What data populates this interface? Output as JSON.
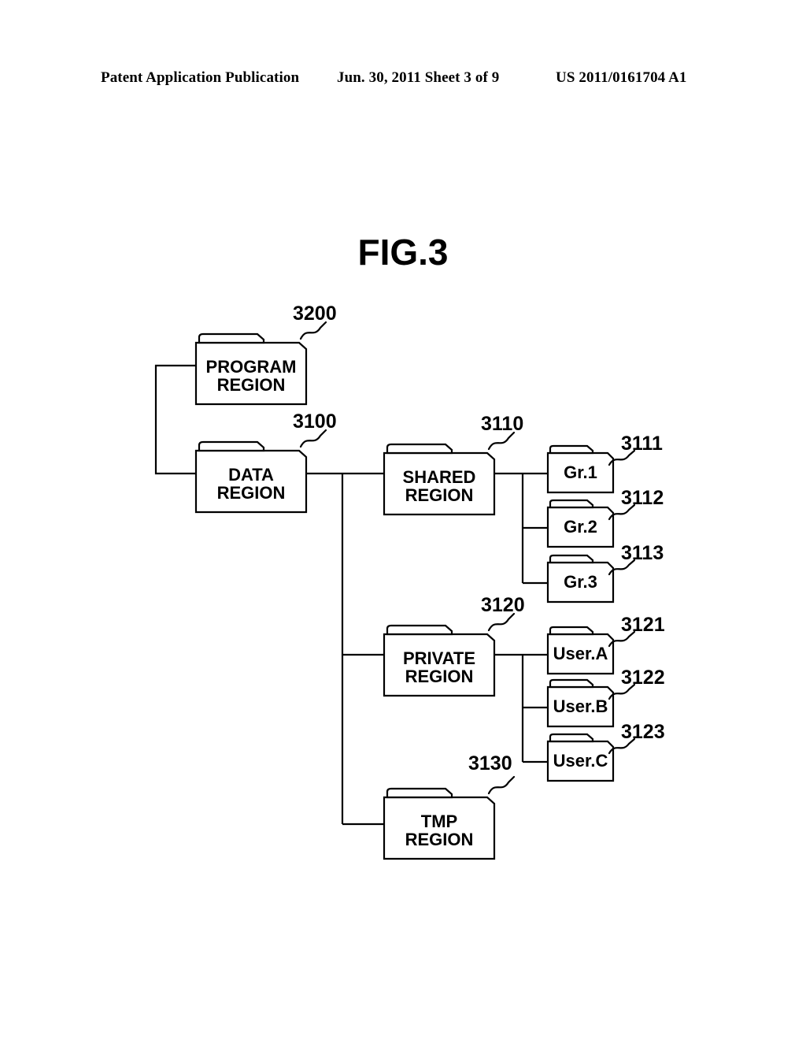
{
  "header": {
    "left": "Patent Application Publication",
    "middle": "Jun. 30, 2011  Sheet 3 of 9",
    "right": "US 2011/0161704 A1"
  },
  "figure": {
    "title": "FIG.3"
  },
  "diagram": {
    "nodes": [
      {
        "id": "program_region",
        "label": "PROGRAM\nREGION",
        "ref": "3200",
        "size": "big"
      },
      {
        "id": "data_region",
        "label": "DATA\nREGION",
        "ref": "3100",
        "size": "big"
      },
      {
        "id": "shared_region",
        "label": "SHARED\nREGION",
        "ref": "3110",
        "size": "big"
      },
      {
        "id": "private_region",
        "label": "PRIVATE\nREGION",
        "ref": "3120",
        "size": "big"
      },
      {
        "id": "tmp_region",
        "label": "TMP\nREGION",
        "ref": "3130",
        "size": "big"
      },
      {
        "id": "gr1",
        "label": "Gr.1",
        "ref": "3111",
        "size": "small"
      },
      {
        "id": "gr2",
        "label": "Gr.2",
        "ref": "3112",
        "size": "small"
      },
      {
        "id": "gr3",
        "label": "Gr.3",
        "ref": "3113",
        "size": "small"
      },
      {
        "id": "user_a",
        "label": "User.A",
        "ref": "3121",
        "size": "small"
      },
      {
        "id": "user_b",
        "label": "User.B",
        "ref": "3122",
        "size": "small"
      },
      {
        "id": "user_c",
        "label": "User.C",
        "ref": "3123",
        "size": "small"
      }
    ],
    "labels": {
      "program_region": "PROGRAM\nREGION",
      "data_region": "DATA\nREGION",
      "shared_region": "SHARED\nREGION",
      "private_region": "PRIVATE\nREGION",
      "tmp_region": "TMP\nREGION",
      "gr1": "Gr.1",
      "gr2": "Gr.2",
      "gr3": "Gr.3",
      "user_a": "User.A",
      "user_b": "User.B",
      "user_c": "User.C"
    },
    "refs": {
      "program_region": "3200",
      "data_region": "3100",
      "shared_region": "3110",
      "private_region": "3120",
      "tmp_region": "3130",
      "gr1": "3111",
      "gr2": "3112",
      "gr3": "3113",
      "user_a": "3121",
      "user_b": "3122",
      "user_c": "3123"
    },
    "colors": {
      "stroke": "#000000",
      "fill": "#ffffff",
      "background": "#ffffff"
    }
  }
}
